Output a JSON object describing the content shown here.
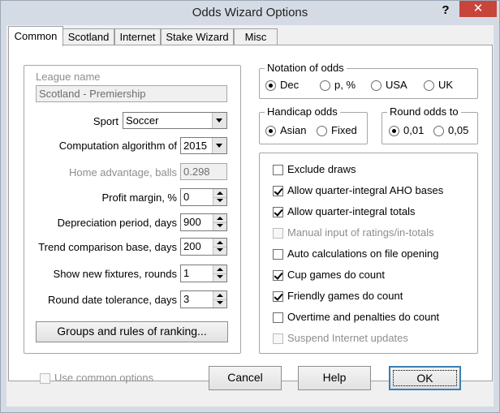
{
  "window": {
    "title": "Odds Wizard Options",
    "help": "?",
    "close": "✕"
  },
  "tabs": [
    "Common",
    "Scotland",
    "Internet",
    "Stake Wizard",
    "Misc"
  ],
  "league": {
    "label": "League name",
    "value": "Scotland - Premiership"
  },
  "fields": {
    "sport": {
      "label": "Sport",
      "value": "Soccer"
    },
    "algorithm": {
      "label": "Computation algorithm of",
      "value": "2015"
    },
    "home_adv": {
      "label": "Home advantage, balls",
      "value": "0.298"
    },
    "profit": {
      "label": "Profit margin, %",
      "value": "0"
    },
    "depreciation": {
      "label": "Depreciation period, days",
      "value": "900"
    },
    "trend": {
      "label": "Trend comparison base, days",
      "value": "200"
    },
    "fixtures": {
      "label": "Show new fixtures, rounds",
      "value": "1"
    },
    "tolerance": {
      "label": "Round date tolerance, days",
      "value": "3"
    }
  },
  "groups_button": "Groups and rules of ranking...",
  "notation": {
    "title": "Notation of odds",
    "options": [
      "Dec",
      "p, %",
      "USA",
      "UK"
    ],
    "selected": 0
  },
  "handicap": {
    "title": "Handicap odds",
    "options": [
      "Asian",
      "Fixed"
    ],
    "selected": 0
  },
  "round": {
    "title": "Round odds to",
    "options": [
      "0,01",
      "0,05"
    ],
    "selected": 0
  },
  "checks": [
    {
      "label": "Exclude draws",
      "checked": false,
      "enabled": true
    },
    {
      "label": "Allow quarter-integral AHO bases",
      "checked": true,
      "enabled": true
    },
    {
      "label": "Allow quarter-integral totals",
      "checked": true,
      "enabled": true
    },
    {
      "label": "Manual input of ratings/in-totals",
      "checked": false,
      "enabled": false
    },
    {
      "label": "Auto calculations on file opening",
      "checked": false,
      "enabled": true
    },
    {
      "label": "Cup games do count",
      "checked": true,
      "enabled": true
    },
    {
      "label": "Friendly games do count",
      "checked": true,
      "enabled": true
    },
    {
      "label": "Overtime and penalties do count",
      "checked": false,
      "enabled": true
    },
    {
      "label": "Suspend Internet updates",
      "checked": false,
      "enabled": false
    }
  ],
  "use_common": "Use common options",
  "buttons": {
    "cancel": "Cancel",
    "help": "Help",
    "ok": "OK"
  }
}
